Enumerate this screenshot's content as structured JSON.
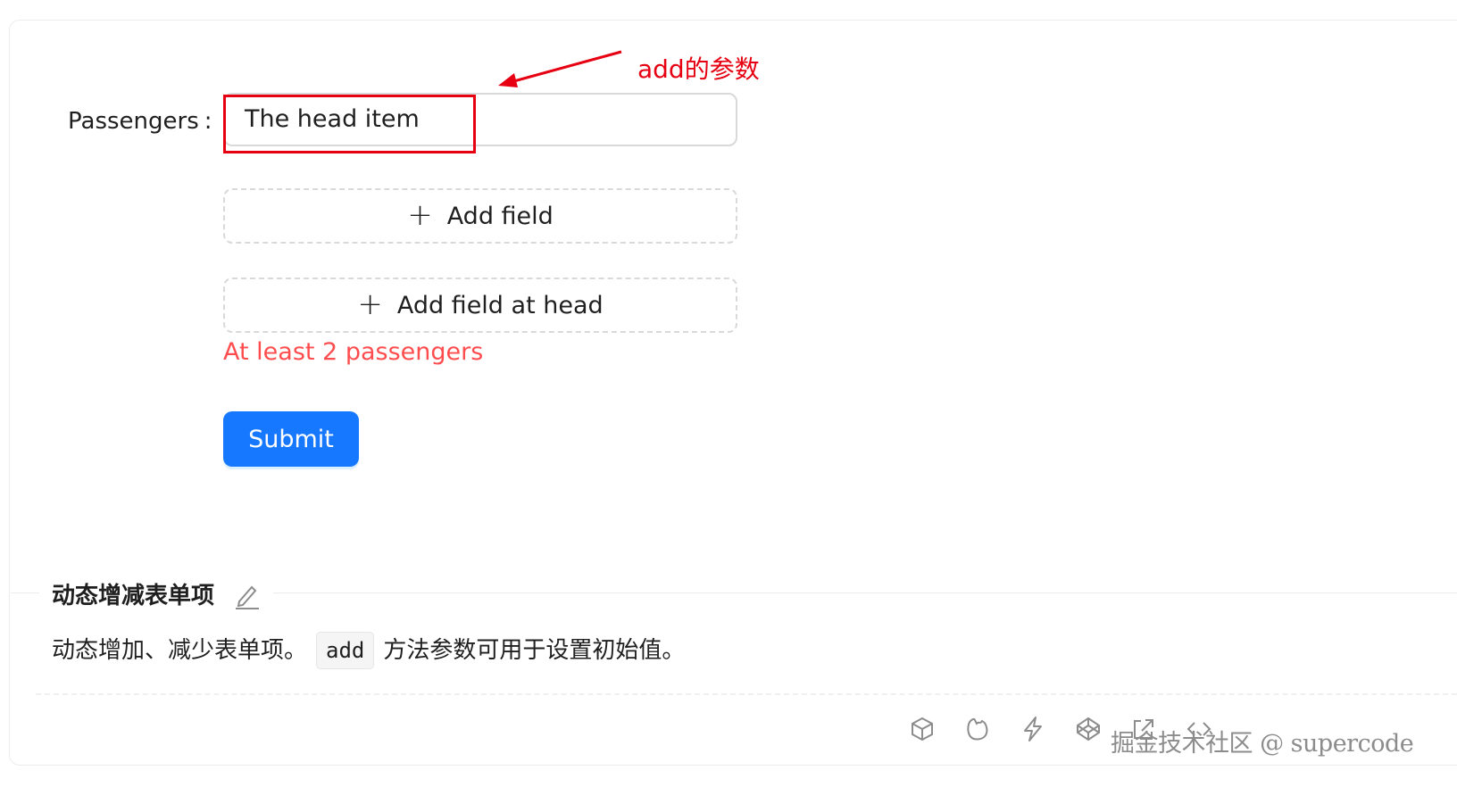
{
  "form": {
    "passengers_label": "Passengers",
    "label_colon": ":",
    "head_item_value": "The head item",
    "add_field_label": "Add field",
    "add_field_at_head_label": "Add field at head",
    "error_message": "At least 2 passengers",
    "submit_label": "Submit"
  },
  "annotation": {
    "text": "add的参数",
    "color": "#e60012"
  },
  "demo": {
    "title": "动态增减表单项",
    "description_before": "动态增加、减少表单项。",
    "code": "add",
    "description_after": "方法参数可用于设置初始值。"
  },
  "toolbar": {
    "icons": [
      "codesandbox-icon",
      "stackblitz-icon",
      "lightning-icon",
      "codepen-icon",
      "external-link-icon",
      "code-icon"
    ]
  },
  "watermark": {
    "text": "掘金技术社区 @ supercode"
  },
  "colors": {
    "primary": "#1677ff",
    "error": "#ff4d4f",
    "annotation_red": "#e60012",
    "border": "#d9d9d9"
  }
}
